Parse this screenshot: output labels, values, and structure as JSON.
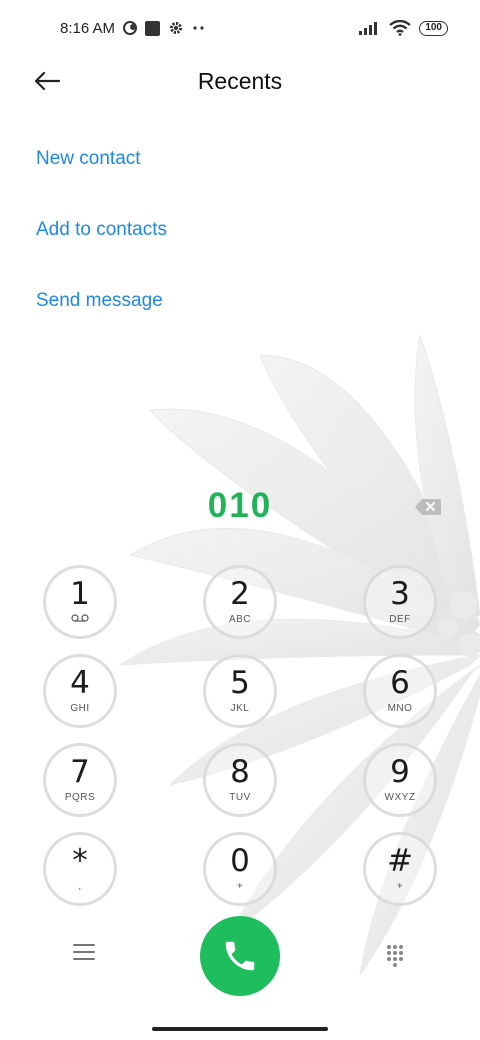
{
  "status_bar": {
    "time": "8:16 AM",
    "battery": "100",
    "icons": [
      "moon-icon",
      "square-icon",
      "gear-icon",
      "dots-icon",
      "signal-icon",
      "wifi-icon",
      "battery-icon"
    ]
  },
  "header": {
    "title": "Recents",
    "back_icon": "arrow-left-icon"
  },
  "options": {
    "new_contact": "New contact",
    "add_to_contacts": "Add to contacts",
    "send_message": "Send message"
  },
  "dialer": {
    "number": "010",
    "keys": [
      {
        "digit": "1",
        "sub": ""
      },
      {
        "digit": "2",
        "sub": "ABC"
      },
      {
        "digit": "3",
        "sub": "DEF"
      },
      {
        "digit": "4",
        "sub": "GHI"
      },
      {
        "digit": "5",
        "sub": "JKL"
      },
      {
        "digit": "6",
        "sub": "MNO"
      },
      {
        "digit": "7",
        "sub": "PQRS"
      },
      {
        "digit": "8",
        "sub": "TUV"
      },
      {
        "digit": "9",
        "sub": "WXYZ"
      },
      {
        "digit": "*",
        "sub": ","
      },
      {
        "digit": "0",
        "sub": "+"
      },
      {
        "digit": "#",
        "sub": "+"
      }
    ]
  },
  "colors": {
    "accent_blue": "#1e88e5",
    "number_green": "#21b357",
    "call_green": "#1fbe5c"
  }
}
